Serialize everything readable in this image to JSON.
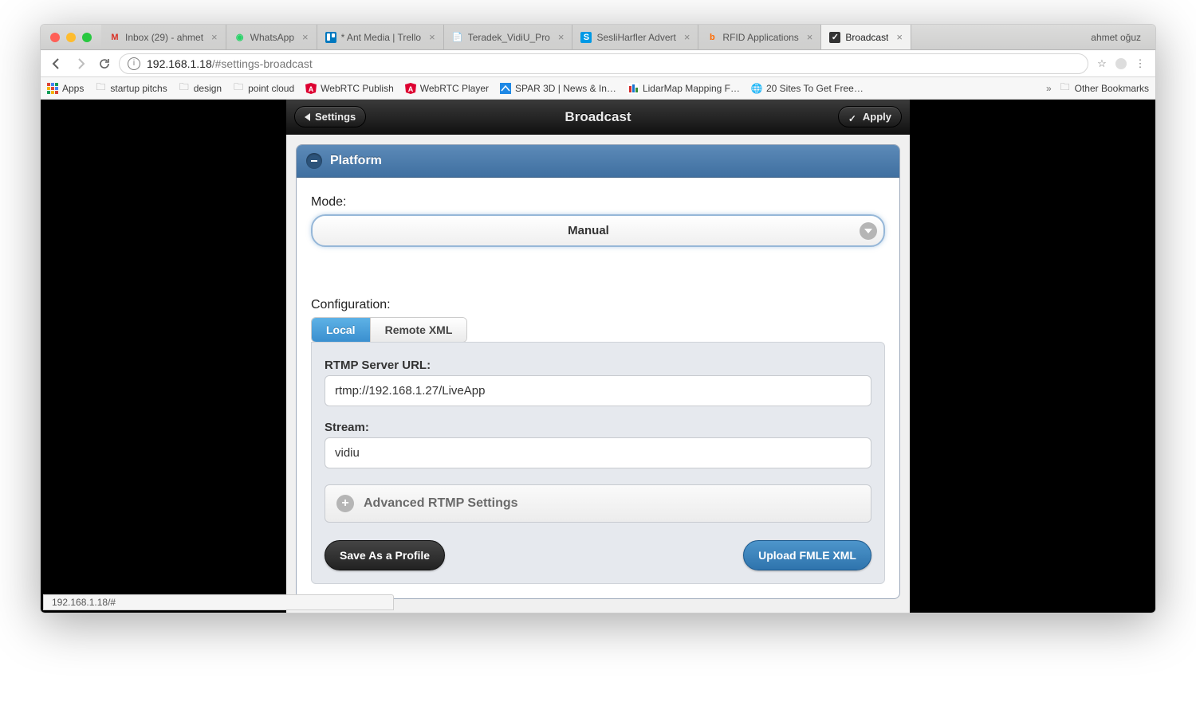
{
  "profile_name": "ahmet oğuz",
  "tabs": [
    {
      "label": "Inbox (29) - ahmet",
      "favicon": "gmail"
    },
    {
      "label": "WhatsApp",
      "favicon": "whatsapp"
    },
    {
      "label": "* Ant Media | Trello",
      "favicon": "trello"
    },
    {
      "label": "Teradek_VidiU_Pro",
      "favicon": "pdf"
    },
    {
      "label": "SesliHarfler Advert",
      "favicon": "s"
    },
    {
      "label": "RFID Applications",
      "favicon": "rfid"
    },
    {
      "label": "Broadcast",
      "favicon": "chk",
      "active": true
    }
  ],
  "address": {
    "host": "192.168.1.18",
    "path": "/#settings-broadcast"
  },
  "bookmarks": {
    "apps_label": "Apps",
    "items": [
      {
        "label": "startup pitchs",
        "icon": "folder"
      },
      {
        "label": "design",
        "icon": "folder"
      },
      {
        "label": "point cloud",
        "icon": "folder"
      },
      {
        "label": "WebRTC Publish",
        "icon": "angular"
      },
      {
        "label": "WebRTC Player",
        "icon": "angular"
      },
      {
        "label": "SPAR 3D | News & In…",
        "icon": "spar"
      },
      {
        "label": "LidarMap Mapping F…",
        "icon": "lidar"
      },
      {
        "label": "20 Sites To Get Free…",
        "icon": "globe"
      }
    ],
    "other": "Other Bookmarks"
  },
  "app": {
    "header": {
      "back": "Settings",
      "title": "Broadcast",
      "apply": "Apply"
    },
    "panel_title": "Platform",
    "mode_label": "Mode:",
    "mode_value": "Manual",
    "config_label": "Configuration:",
    "config_tabs": [
      {
        "label": "Local",
        "active": true
      },
      {
        "label": "Remote XML",
        "active": false
      }
    ],
    "rtmp_label": "RTMP Server URL:",
    "rtmp_value": "rtmp://192.168.1.27/LiveApp",
    "stream_label": "Stream:",
    "stream_value": "vidiu",
    "adv_label": "Advanced RTMP Settings",
    "save_btn": "Save As a Profile",
    "upload_btn": "Upload FMLE XML"
  },
  "status_text": "192.168.1.18/#"
}
